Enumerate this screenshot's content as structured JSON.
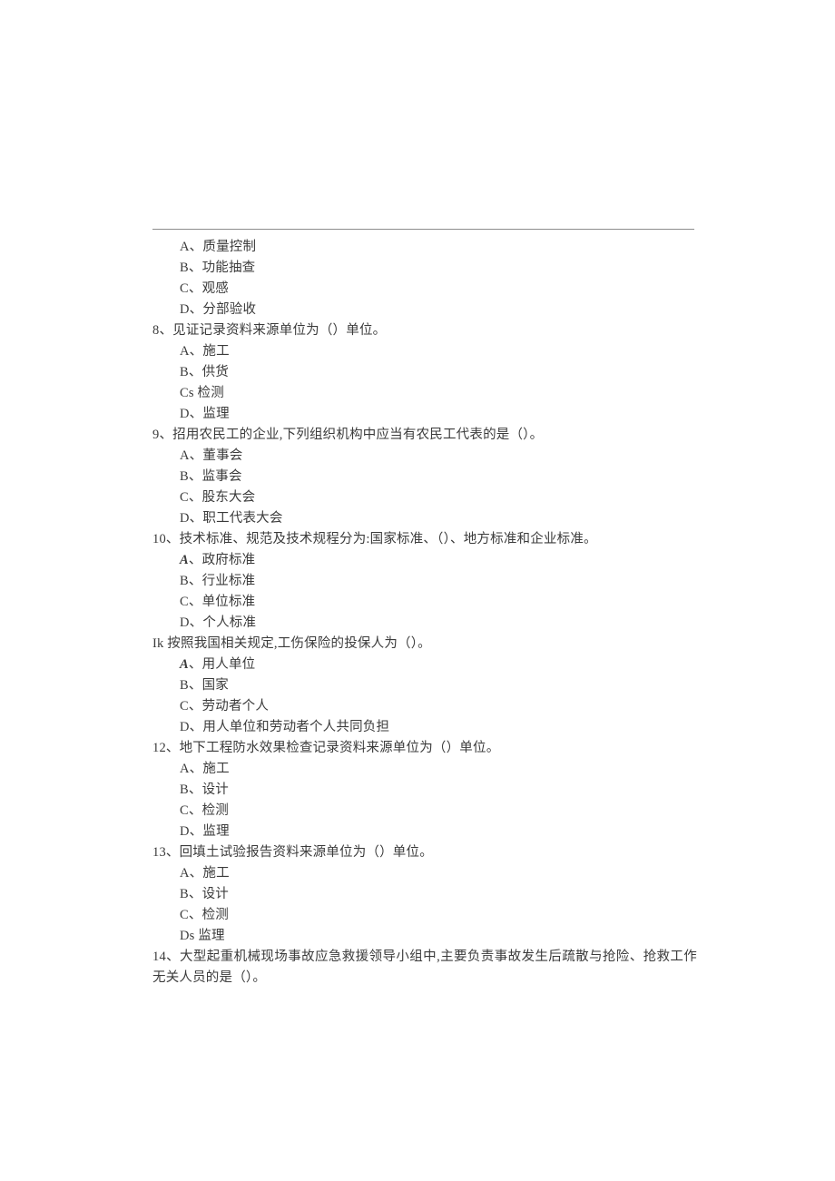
{
  "document": {
    "type": "scanned-exam-paper",
    "language": "zh-CN",
    "divider": "horizontal-rule"
  },
  "items": [
    {
      "kind": "option",
      "text": "A、质量控制",
      "emphasis": false
    },
    {
      "kind": "option",
      "text": "B、功能抽查",
      "emphasis": false
    },
    {
      "kind": "option",
      "text": "C、观感",
      "emphasis": false
    },
    {
      "kind": "option",
      "text": "D、分部验收",
      "emphasis": false
    },
    {
      "kind": "question",
      "text": "8、见证记录资料来源单位为（）单位。",
      "wrap": false
    },
    {
      "kind": "option",
      "text": "A、施工",
      "emphasis": false
    },
    {
      "kind": "option",
      "text": "B、供货",
      "emphasis": false
    },
    {
      "kind": "option",
      "text": "Cs 检测",
      "emphasis": false
    },
    {
      "kind": "option",
      "text": "D、监理",
      "emphasis": false
    },
    {
      "kind": "question",
      "text": "9、招用农民工的企业,下列组织机构中应当有农民工代表的是（）。",
      "wrap": false
    },
    {
      "kind": "option",
      "text": "A、董事会",
      "emphasis": false
    },
    {
      "kind": "option",
      "text": "B、监事会",
      "emphasis": false
    },
    {
      "kind": "option",
      "text": "C、股东大会",
      "emphasis": false
    },
    {
      "kind": "option",
      "text": "D、职工代表大会",
      "emphasis": false
    },
    {
      "kind": "question",
      "text": "10、技术标准、规范及技术规程分为:国家标准、（）、地方标准和企业标准。",
      "wrap": false
    },
    {
      "kind": "option",
      "text": "A",
      "body": "、政府标准",
      "emphasis": true
    },
    {
      "kind": "option",
      "text": "B、行业标准",
      "emphasis": false
    },
    {
      "kind": "option",
      "text": "C、单位标准",
      "emphasis": false
    },
    {
      "kind": "option",
      "text": "D、个人标准",
      "emphasis": false
    },
    {
      "kind": "question",
      "text": "Ik 按照我国相关规定,工伤保险的投保人为（）。",
      "wrap": false
    },
    {
      "kind": "option",
      "text": "A",
      "body": "、用人单位",
      "emphasis": true
    },
    {
      "kind": "option",
      "text": "B、国家",
      "emphasis": false
    },
    {
      "kind": "option",
      "text": "C、劳动者个人",
      "emphasis": false
    },
    {
      "kind": "option",
      "text": "D、用人单位和劳动者个人共同负担",
      "emphasis": false
    },
    {
      "kind": "question",
      "text": "12、地下工程防水效果检查记录资料来源单位为（）单位。",
      "wrap": false
    },
    {
      "kind": "option",
      "text": "A、施工",
      "emphasis": false
    },
    {
      "kind": "option",
      "text": "B、设计",
      "emphasis": false
    },
    {
      "kind": "option",
      "text": "C、检测",
      "emphasis": false
    },
    {
      "kind": "option",
      "text": "D、监理",
      "emphasis": false
    },
    {
      "kind": "question",
      "text": "13、回填土试验报告资料来源单位为（）单位。",
      "wrap": false
    },
    {
      "kind": "option",
      "text": "A、施工",
      "emphasis": false
    },
    {
      "kind": "option",
      "text": "B、设计",
      "emphasis": false
    },
    {
      "kind": "option",
      "text": "C、检测",
      "emphasis": false
    },
    {
      "kind": "option",
      "text": "Ds 监理",
      "emphasis": false
    },
    {
      "kind": "question",
      "text": "14、大型起重机械现场事故应急救援领导小组中,主要负责事故发生后疏散与抢险、抢救工作无关人员的是（）。",
      "wrap": true
    }
  ]
}
